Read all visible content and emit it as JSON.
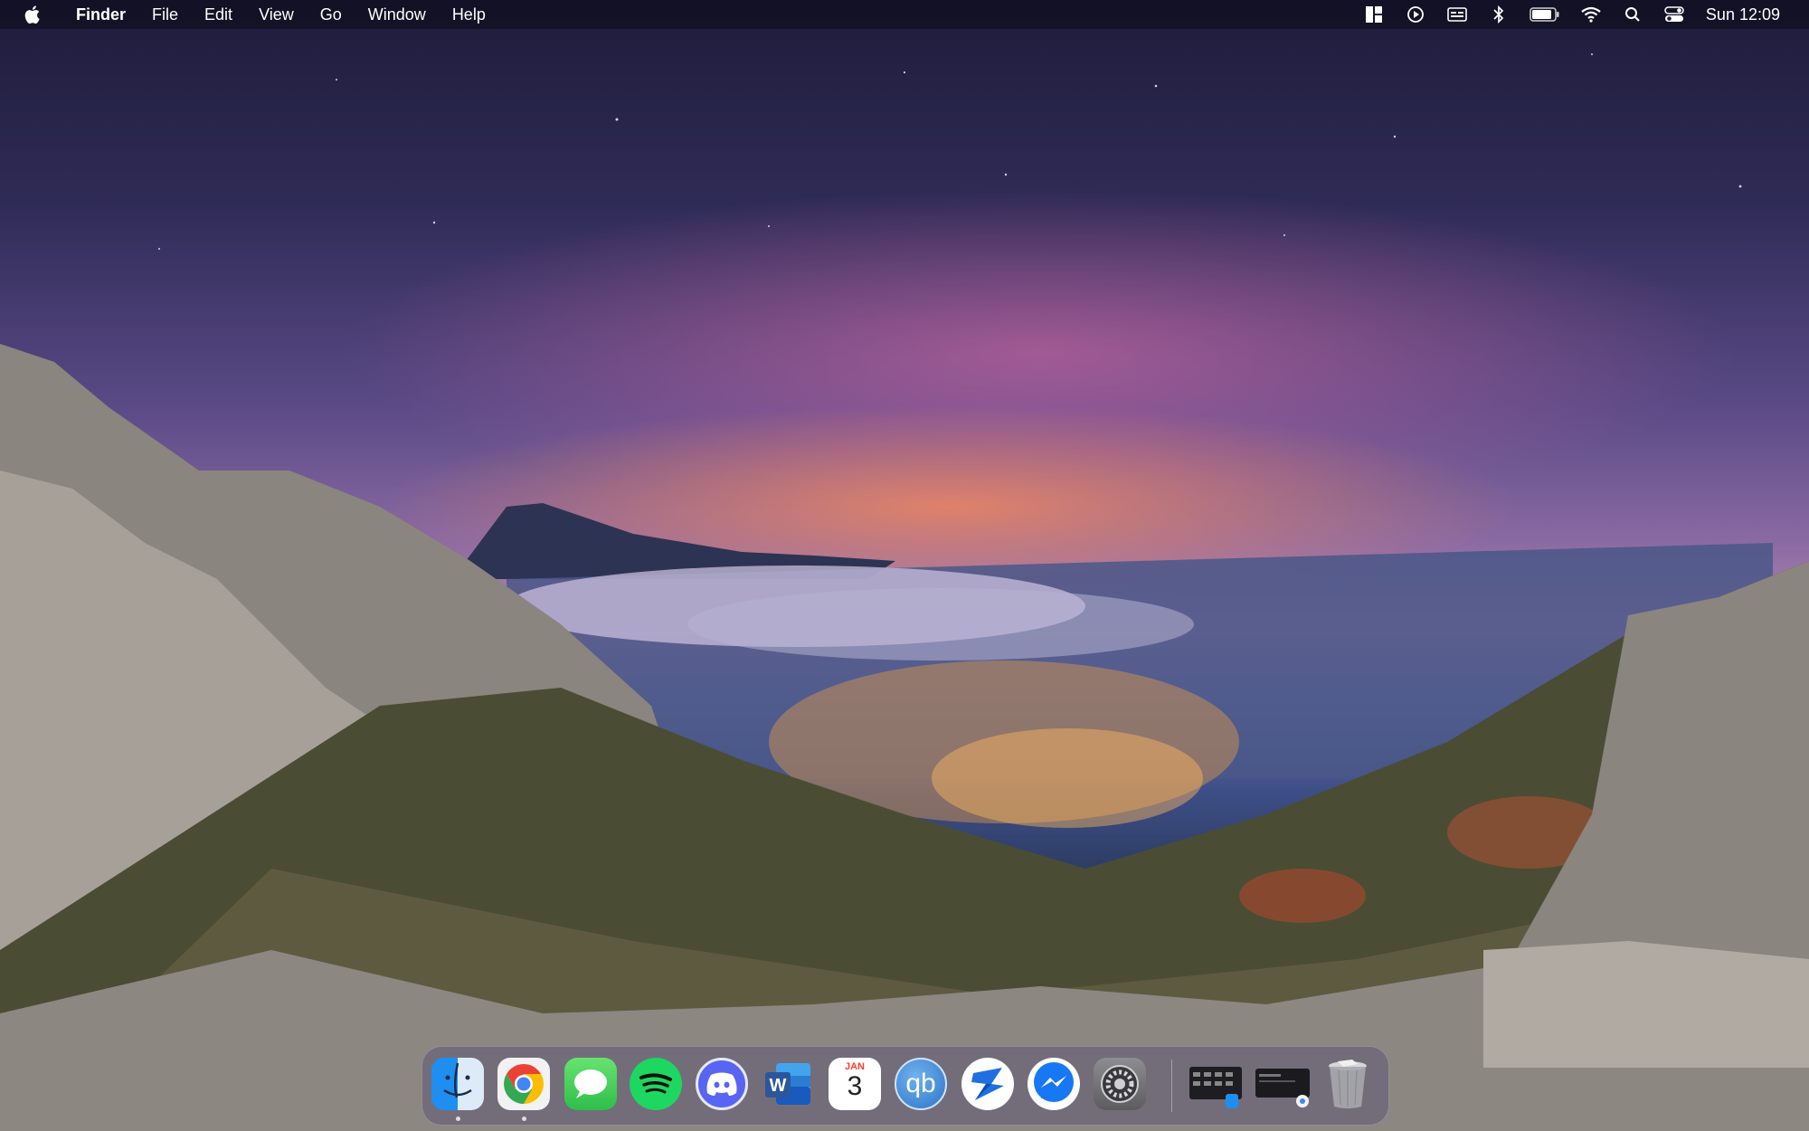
{
  "menubar": {
    "app_name": "Finder",
    "menus": [
      "File",
      "Edit",
      "View",
      "Go",
      "Window",
      "Help"
    ],
    "status_icons": [
      "window-layout-icon",
      "play-circle-icon",
      "keyboard-input-icon",
      "bluetooth-icon",
      "battery-icon",
      "wifi-icon",
      "spotlight-search-icon",
      "control-center-icon"
    ],
    "clock": "Sun 12:09"
  },
  "dock": {
    "apps": [
      {
        "name": "Finder",
        "icon": "finder-icon",
        "running": true
      },
      {
        "name": "Google Chrome",
        "icon": "chrome-icon",
        "running": true
      },
      {
        "name": "Messages",
        "icon": "messages-icon",
        "running": false
      },
      {
        "name": "Spotify",
        "icon": "spotify-icon",
        "running": false
      },
      {
        "name": "Discord",
        "icon": "discord-icon",
        "running": false
      },
      {
        "name": "Microsoft Word",
        "icon": "word-icon",
        "running": false
      },
      {
        "name": "Calendar",
        "icon": "calendar-icon",
        "running": false
      },
      {
        "name": "qBittorrent",
        "icon": "qbittorrent-icon",
        "running": false
      },
      {
        "name": "Spark",
        "icon": "spark-mail-icon",
        "running": false
      },
      {
        "name": "Messenger",
        "icon": "messenger-icon",
        "running": false
      },
      {
        "name": "System Preferences",
        "icon": "system-preferences-icon",
        "running": false
      }
    ],
    "calendar": {
      "month": "JAN",
      "day": "3"
    },
    "qbittorrent_label": "qb",
    "word_letter": "W",
    "minimized": [
      {
        "icon": "finder-window-thumbnail-icon"
      },
      {
        "icon": "chrome-window-thumbnail-icon"
      }
    ],
    "trash": {
      "icon": "trash-icon"
    }
  },
  "colors": {
    "menubar_bg": "#0e0e1e",
    "spotify_green": "#1ed760",
    "discord_blue": "#5865f2",
    "word_blue": "#2b579a",
    "messages_green": "#34c759"
  }
}
